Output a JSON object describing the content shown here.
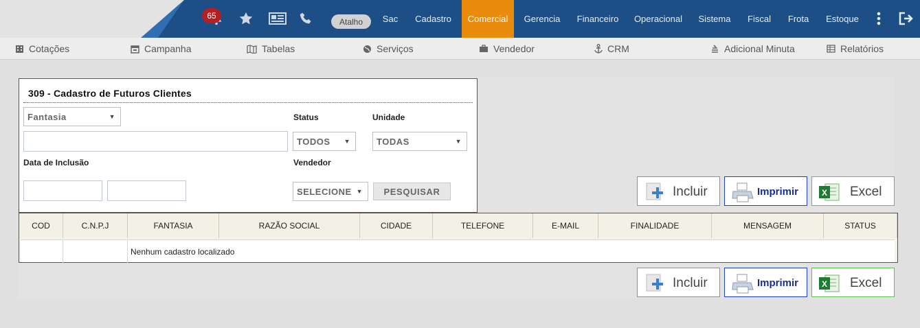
{
  "topbar": {
    "notification_count": "65",
    "atalho_label": "Atalho",
    "nav": [
      {
        "label": "Sac",
        "active": false
      },
      {
        "label": "Cadastro",
        "active": false
      },
      {
        "label": "Comercial",
        "active": true
      },
      {
        "label": "Gerencia",
        "active": false
      },
      {
        "label": "Financeiro",
        "active": false
      },
      {
        "label": "Operacional",
        "active": false
      },
      {
        "label": "Sistema",
        "active": false
      },
      {
        "label": "Fiscal",
        "active": false
      },
      {
        "label": "Frota",
        "active": false
      },
      {
        "label": "Estoque",
        "active": false
      }
    ],
    "active_color": "#e98b0c",
    "bar_color": "#1d4f86"
  },
  "subnav": [
    {
      "label": "Cotações",
      "icon": "building-icon"
    },
    {
      "label": "Campanha",
      "icon": "calendar-icon"
    },
    {
      "label": "Tabelas",
      "icon": "map-icon"
    },
    {
      "label": "Serviços",
      "icon": "globe-icon"
    },
    {
      "label": "Vendedor",
      "icon": "briefcase-icon"
    },
    {
      "label": "CRM",
      "icon": "anchor-icon"
    },
    {
      "label": "Adicional Minuta",
      "icon": "stack-icon"
    },
    {
      "label": "Relatórios",
      "icon": "table-icon"
    }
  ],
  "form": {
    "title": "309 - Cadastro de Futuros Clientes",
    "search_field_select": "Fantasia",
    "search_value": "",
    "status_label": "Status",
    "status_value": "TODOS",
    "unidade_label": "Unidade",
    "unidade_value": "TODAS",
    "data_label": "Data de Inclusão",
    "date_from": "",
    "date_to": "",
    "vendedor_label": "Vendedor",
    "vendedor_value": "SELECIONE",
    "search_button": "PESQUISAR"
  },
  "actions": {
    "incluir": "Incluir",
    "imprimir": "Imprimir",
    "excel": "Excel"
  },
  "table": {
    "columns": [
      "COD",
      "C.N.P.J",
      "FANTASIA",
      "RAZÃO SOCIAL",
      "CIDADE",
      "TELEFONE",
      "E-MAIL",
      "FINALIDADE",
      "MENSAGEM",
      "STATUS"
    ],
    "empty_message": "Nenhum cadastro localizado"
  }
}
